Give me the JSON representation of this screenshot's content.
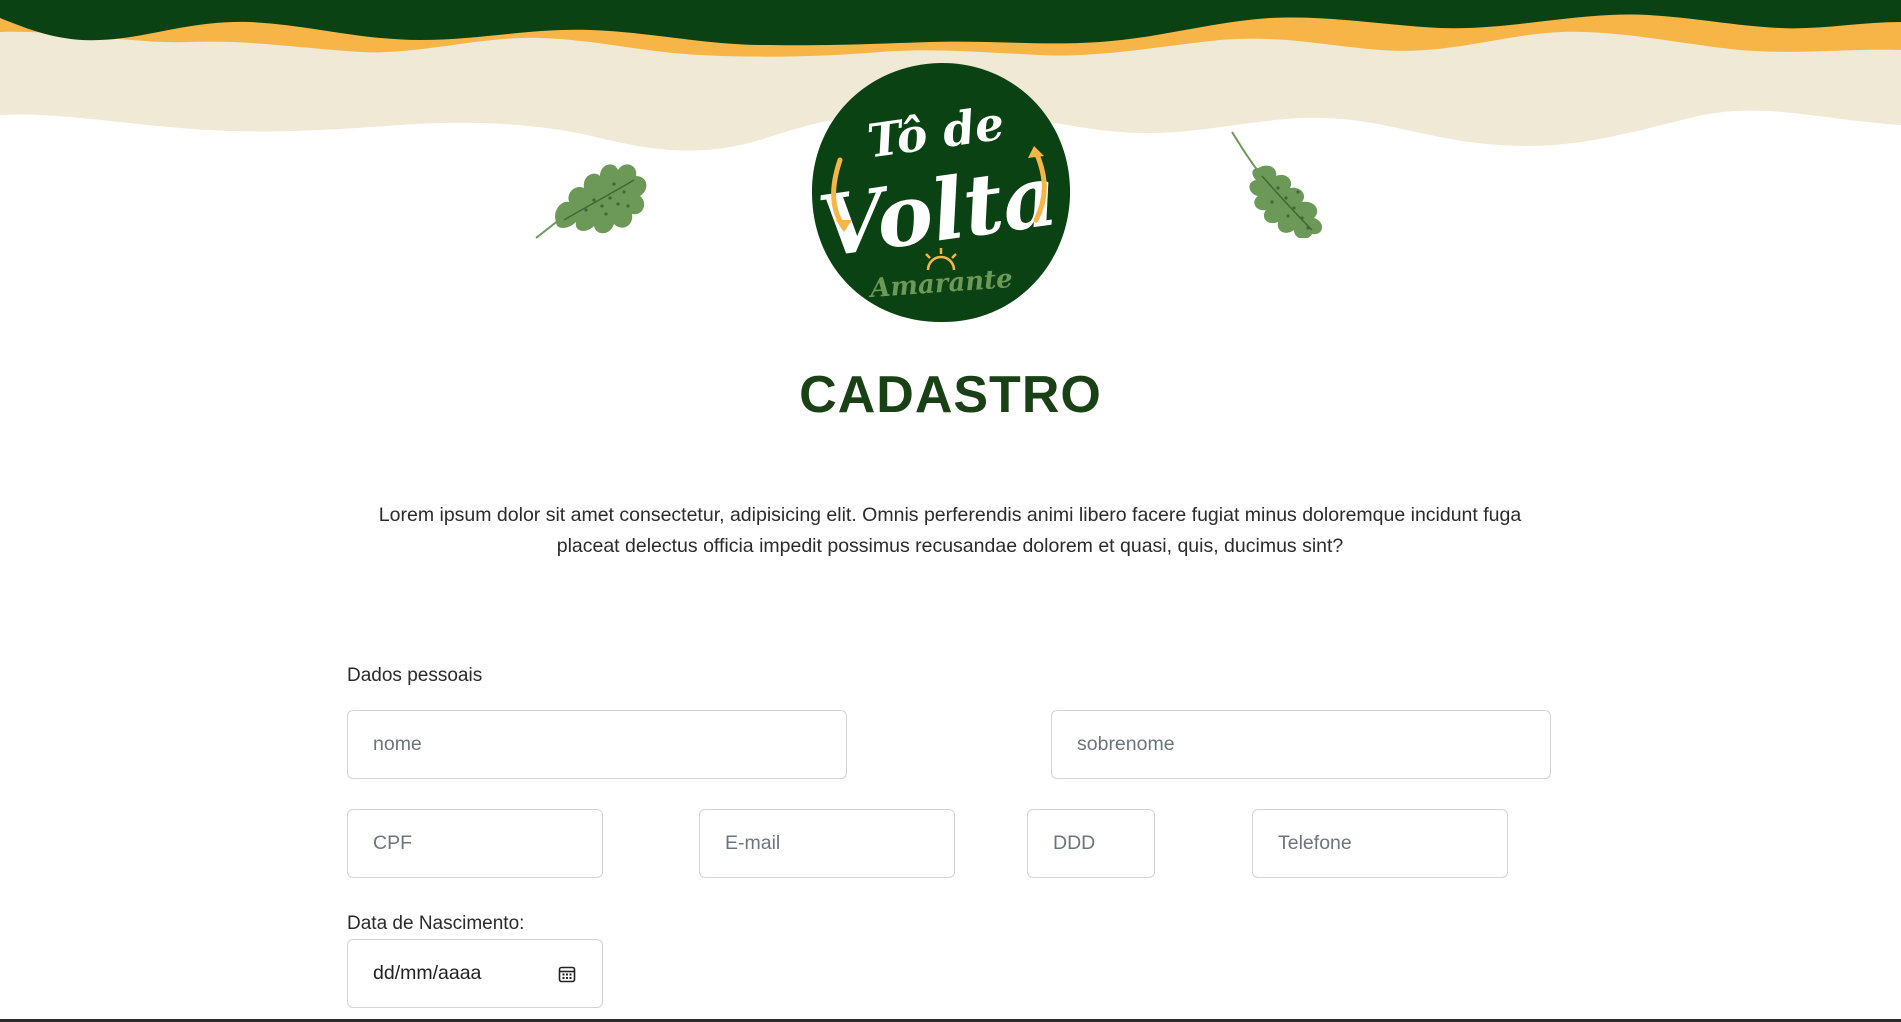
{
  "brand": {
    "logo_line1": "Tô de",
    "logo_line2": "Volta",
    "logo_line3": "Amarante",
    "colors": {
      "dark_green": "#0b4214",
      "orange": "#f7b547",
      "cream": "#efe9d6",
      "leaf_green": "#6c9858",
      "title_green": "#1a4016"
    }
  },
  "page": {
    "title": "CADASTRO",
    "intro": "Lorem ipsum dolor sit amet consectetur, adipisicing elit. Omnis perferendis animi libero facere fugiat minus doloremque incidunt fuga placeat delectus officia impedit possimus recusandae dolorem et quasi, quis, ducimus sint?"
  },
  "form": {
    "section_label": "Dados pessoais",
    "fields": {
      "nome": {
        "placeholder": "nome",
        "value": ""
      },
      "sobrenome": {
        "placeholder": "sobrenome",
        "value": ""
      },
      "cpf": {
        "placeholder": "CPF",
        "value": ""
      },
      "email": {
        "placeholder": "E-mail",
        "value": ""
      },
      "ddd": {
        "placeholder": "DDD",
        "value": ""
      },
      "telefone": {
        "placeholder": "Telefone",
        "value": ""
      }
    },
    "date_label": "Data de Nascimento:",
    "date_value": "dd/mm/aaaa",
    "date_icon": "calendar-icon"
  }
}
